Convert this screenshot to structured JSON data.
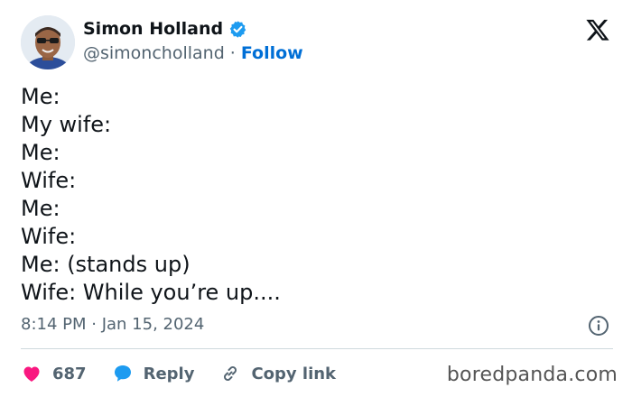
{
  "author": {
    "display_name": "Simon Holland",
    "handle": "@simoncholland",
    "separator": "·",
    "follow_label": "Follow",
    "verified": true
  },
  "tweet": {
    "lines": [
      "Me:",
      "My wife:",
      "Me:",
      "Wife:",
      "Me:",
      "Wife:",
      "Me: (stands up)",
      "Wife: While you’re up...."
    ],
    "timestamp": "8:14 PM · Jan 15, 2024"
  },
  "actions": {
    "like_count": "687",
    "reply_label": "Reply",
    "copy_link_label": "Copy link"
  },
  "watermark": "boredpanda.com",
  "icons": {
    "verified": "verified-badge-icon",
    "x_logo": "x-logo-icon",
    "info": "info-icon",
    "like": "heart-icon",
    "reply": "speech-bubble-icon",
    "copy_link": "link-icon"
  },
  "colors": {
    "verified": "#1d9bf0",
    "follow": "#006fd6",
    "heart": "#f91880",
    "reply_bubble": "#1d9bf0",
    "muted_text": "#536471",
    "text": "#0f1419"
  }
}
